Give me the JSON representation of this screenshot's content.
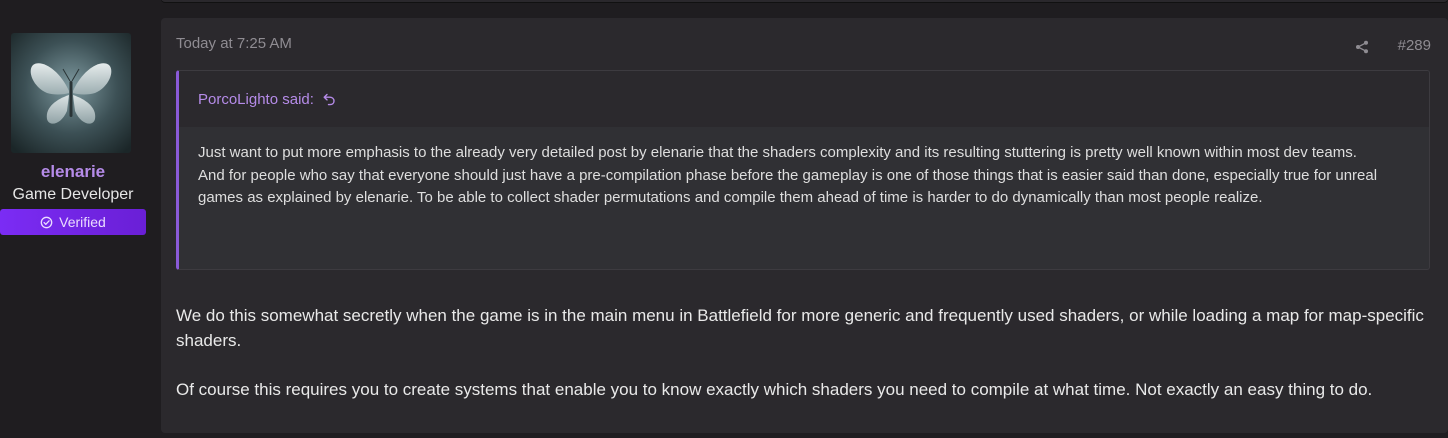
{
  "user": {
    "name": "elenarie",
    "title": "Game Developer",
    "badge": "Verified",
    "avatar_icon": "butterfly-icon",
    "badge_icon": "check-circle-icon"
  },
  "post": {
    "date": "Today at 7:25 AM",
    "number": "#289",
    "share_icon": "share-icon",
    "quote": {
      "author": "PorcoLighto said:",
      "jump_icon": "reply-arrow-icon",
      "paragraphs": [
        "Just want to put more emphasis to the already very detailed post by elenarie that the shaders complexity and its resulting stuttering is pretty well known within most dev teams.",
        "And for people who say that everyone should just have a pre-compilation phase before the gameplay is one of those things that is easier said than done, especially true for unreal games as explained by elenarie. To be able to collect shader permutations and compile them ahead of time is harder to do dynamically than most people realize."
      ]
    },
    "body": [
      "We do this somewhat secretly when the game is in the main menu in Battlefield for more generic and frequently used shaders, or while loading a map for map-specific shaders.",
      "Of course this requires you to create systems that enable you to know exactly which shaders you need to compile at what time. Not exactly an easy thing to do."
    ]
  },
  "colors": {
    "accent": "#b58be8",
    "badge": "#7b2cf4",
    "quote_border": "#8a5ad8",
    "background": "#1f1d20",
    "post_bg": "#2b292d"
  }
}
